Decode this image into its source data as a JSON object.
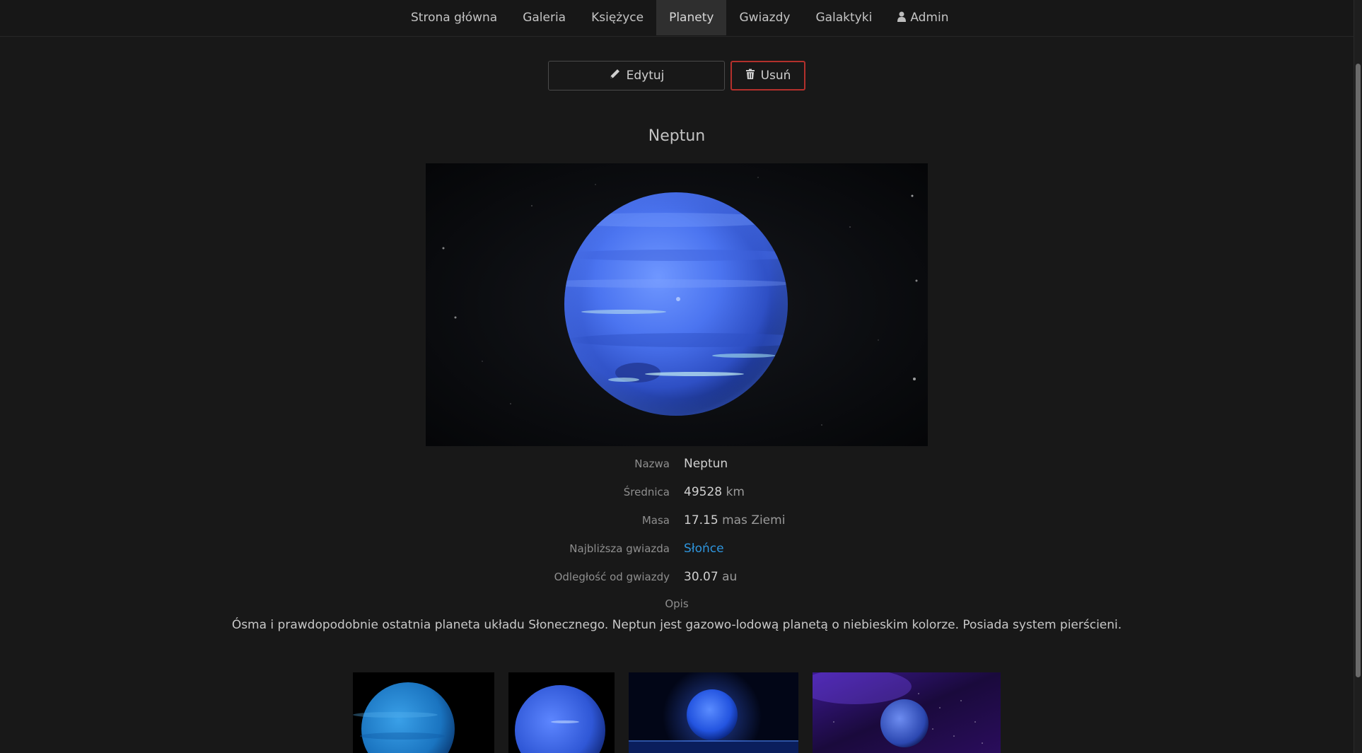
{
  "nav": {
    "items": [
      {
        "label": "Strona główna",
        "active": false
      },
      {
        "label": "Galeria",
        "active": false
      },
      {
        "label": "Księżyce",
        "active": false
      },
      {
        "label": "Planety",
        "active": true
      },
      {
        "label": "Gwiazdy",
        "active": false
      },
      {
        "label": "Galaktyki",
        "active": false
      }
    ],
    "admin": {
      "label": "Admin",
      "icon": "user-icon"
    }
  },
  "actions": {
    "edit": {
      "label": "Edytuj",
      "icon": "pencil-icon"
    },
    "delete": {
      "label": "Usuń",
      "icon": "trash-icon",
      "border_color": "#b3302c"
    }
  },
  "planet": {
    "title": "Neptun",
    "fields": {
      "name": {
        "label": "Nazwa",
        "value": "Neptun"
      },
      "diameter": {
        "label": "Średnica",
        "value": "49528",
        "unit": "km"
      },
      "mass": {
        "label": "Masa",
        "value": "17.15",
        "unit": "mas Ziemi"
      },
      "star": {
        "label": "Najbliższa gwiazda",
        "value": "Słońce",
        "link_color": "#2e95dd"
      },
      "distance": {
        "label": "Odległość od gwiazdy",
        "value": "30.07",
        "unit": "au"
      }
    },
    "description_label": "Opis",
    "description": "Ósma i prawdopodobnie ostatnia planeta układu Słonecznego. Neptun jest gazowo-lodową planetą o niebieskim kolorze. Posiada system pierścieni."
  },
  "colors": {
    "background": "#181818",
    "active_nav": "#2f2f2f",
    "link": "#2e95dd",
    "danger": "#b3302c"
  }
}
